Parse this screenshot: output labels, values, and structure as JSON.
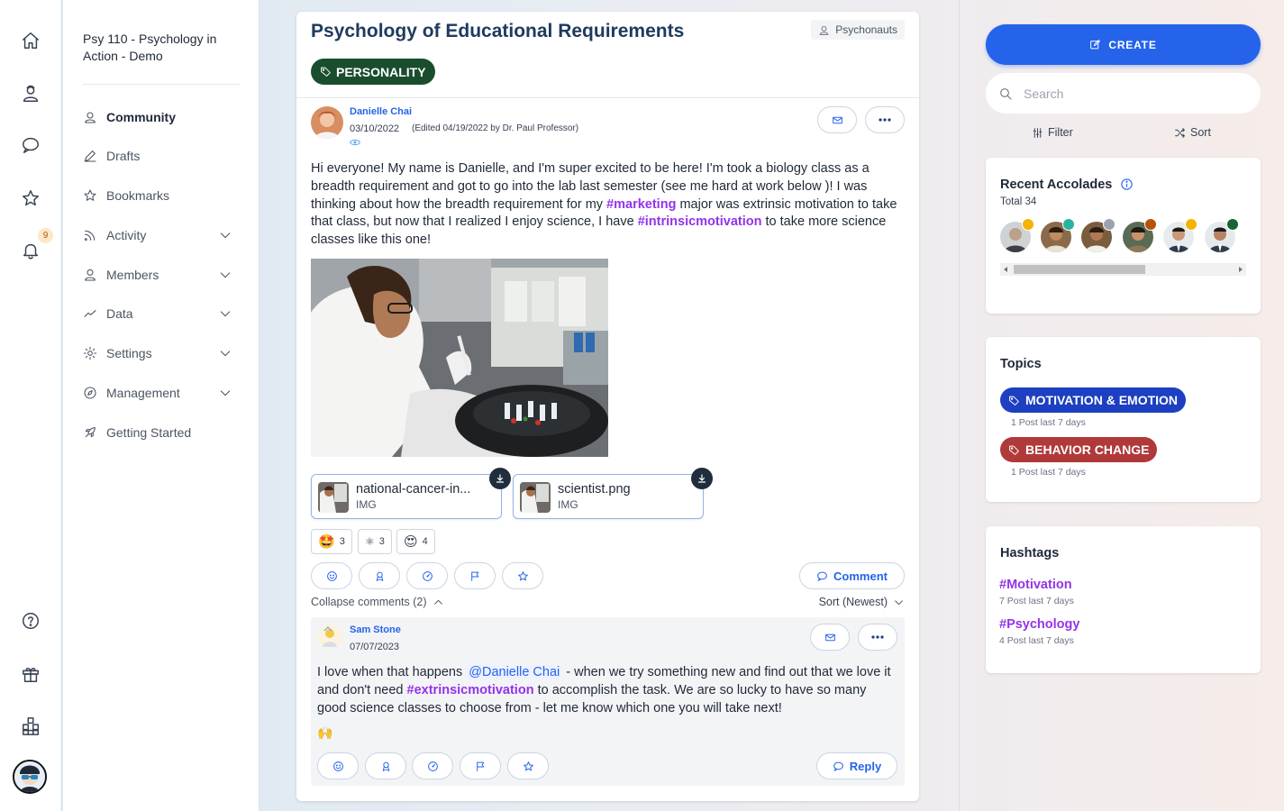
{
  "course": {
    "title": "Psy 110 - Psychology in Action - Demo"
  },
  "rail": {
    "notification_count": "9"
  },
  "nav": {
    "items": [
      {
        "label": "Community",
        "icon": "community-icon"
      },
      {
        "label": "Drafts",
        "icon": "pencil-icon"
      },
      {
        "label": "Bookmarks",
        "icon": "star-icon"
      },
      {
        "label": "Activity",
        "icon": "rss-icon"
      },
      {
        "label": "Members",
        "icon": "user-icon"
      },
      {
        "label": "Data",
        "icon": "trend-icon"
      },
      {
        "label": "Settings",
        "icon": "gear-icon"
      },
      {
        "label": "Management",
        "icon": "compass-icon"
      },
      {
        "label": "Getting Started",
        "icon": "rocket-icon"
      }
    ]
  },
  "post": {
    "title": "Psychology of Educational Requirements",
    "group": "Psychonauts",
    "tag": "PERSONALITY",
    "author": "Danielle Chai",
    "date": "03/10/2022",
    "edited": "(Edited 04/19/2022 by Dr. Paul Professor)",
    "body_1": "Hi everyone! My name is Danielle, and I'm super excited to be here! I'm took a biology class as a breadth requirement and got to go into the lab last semester (see me hard at work below )! I was thinking about how the breadth requirement for my ",
    "hashtag_1": "#marketing",
    "body_2": " major was extrinsic motivation to take that class, but now that I realized I enjoy science, I have ",
    "hashtag_2": "#intrinsicmotivation",
    "body_3": " to take more science classes like this one!",
    "attachments": [
      {
        "name": "national-cancer-in...",
        "type": "IMG"
      },
      {
        "name": "scientist.png",
        "type": "IMG"
      }
    ],
    "reactions": [
      {
        "emoji": "🤩",
        "count": "3"
      },
      {
        "emoji": "⚛",
        "count": "3"
      },
      {
        "emoji": "😍",
        "count": "4"
      }
    ],
    "comment_label": "Comment",
    "collapse_label": "Collapse comments (2)",
    "sort_label": "Sort (Newest)"
  },
  "comment": {
    "author": "Sam Stone",
    "date": "07/07/2023",
    "body_1": "I love when that happens ",
    "mention": "@Danielle Chai",
    "body_2": " - when we try something new and find out that we love it and don't need ",
    "hashtag": "#extrinsicmotivation",
    "body_3": " to accomplish the task. We are so lucky to have so many good science classes to choose from - let me know which one you will take next!",
    "emoji": "🙌",
    "reply_label": "Reply"
  },
  "sidebar": {
    "create_label": "CREATE",
    "search_placeholder": "Search",
    "filter_label": "Filter",
    "sort_label": "Sort",
    "accolades": {
      "title": "Recent Accolades",
      "total": "Total 34",
      "medal_colors": [
        "#f5b301",
        "#2bb3a0",
        "#9ca3af",
        "#b45309",
        "#f5b301",
        "#166534"
      ]
    },
    "topics": {
      "title": "Topics",
      "items": [
        {
          "label": "MOTIVATION & EMOTION",
          "meta": "1 Post last 7 days",
          "color": "#1d3fc1"
        },
        {
          "label": "BEHAVIOR CHANGE",
          "meta": "1 Post last 7 days",
          "color": "#b03a3a"
        }
      ]
    },
    "hashtags": {
      "title": "Hashtags",
      "items": [
        {
          "label": "#Motivation",
          "meta": "7 Post last 7 days"
        },
        {
          "label": "#Psychology",
          "meta": "4 Post last 7 days"
        }
      ]
    }
  },
  "colors": {
    "accent": "#2563eb",
    "hashtag": "#9333ea",
    "tag_green": "#1a4d2e"
  }
}
